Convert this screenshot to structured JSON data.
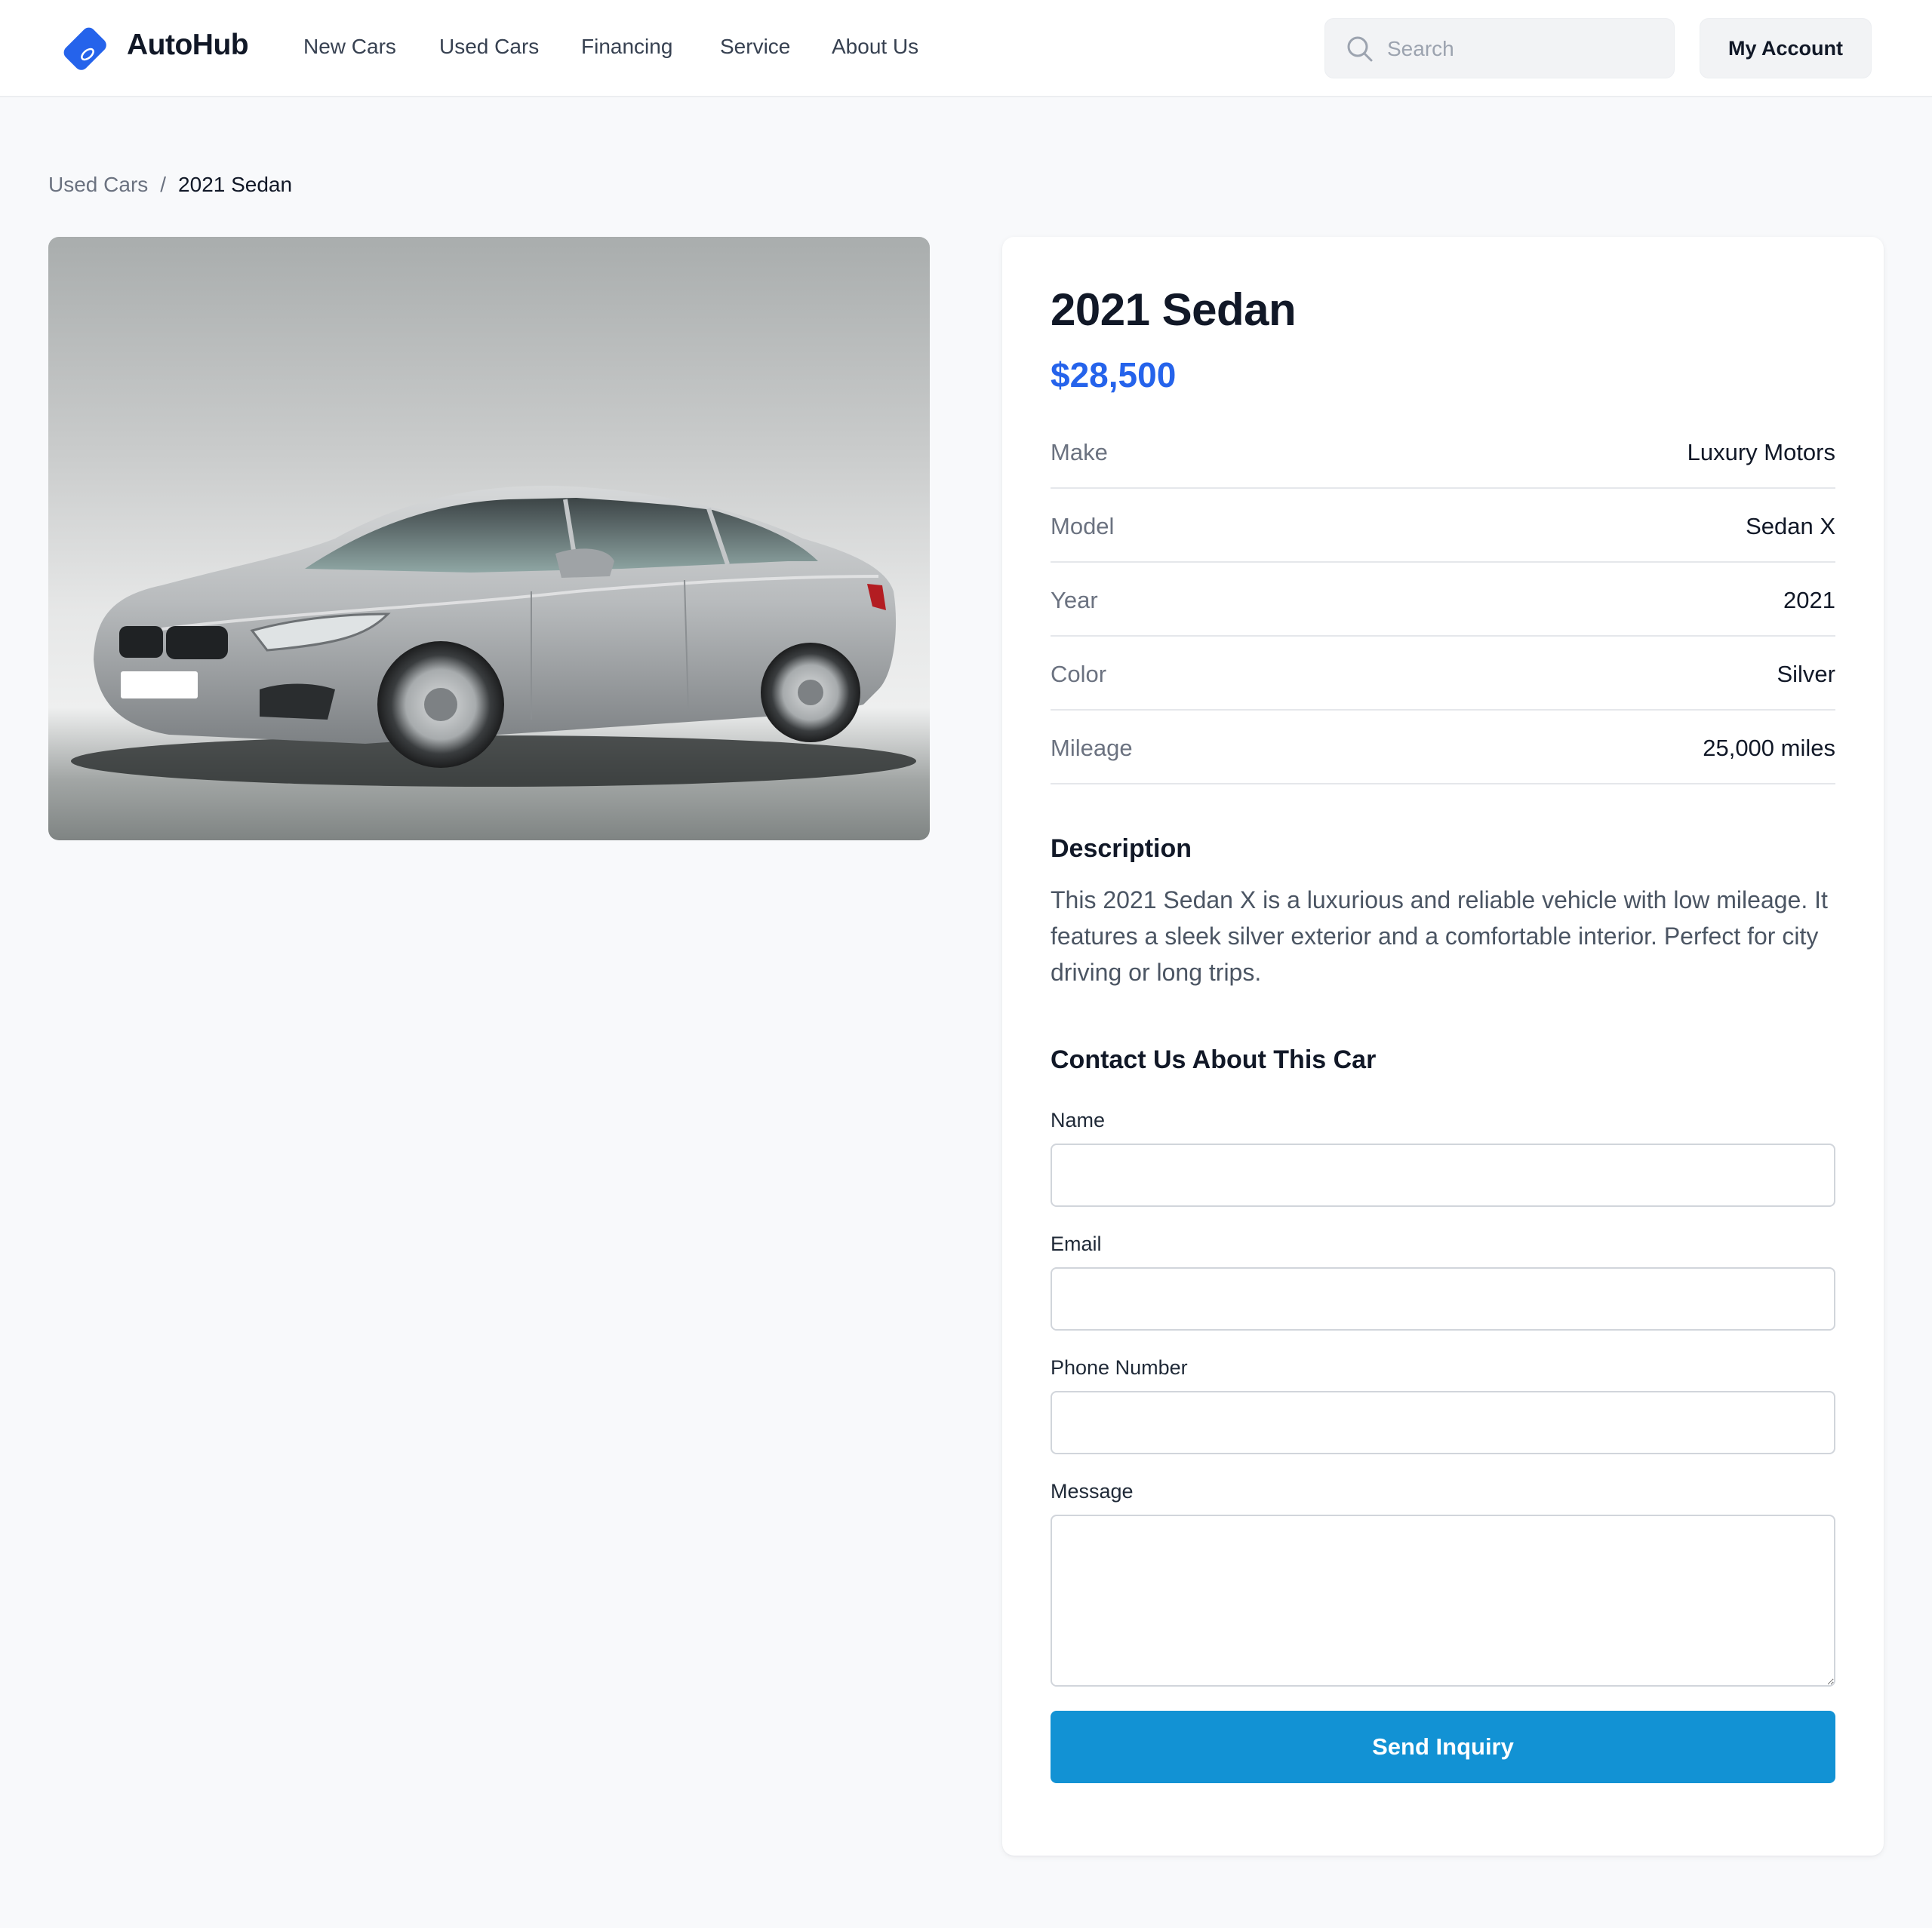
{
  "brand": {
    "name": "AutoHub",
    "accent": "#2563eb",
    "logo_icon": "tag-icon"
  },
  "nav": {
    "items": [
      {
        "label": "New Cars"
      },
      {
        "label": "Used Cars"
      },
      {
        "label": "Financing"
      },
      {
        "label": "Service"
      },
      {
        "label": "About Us"
      }
    ]
  },
  "search": {
    "placeholder": "Search",
    "value": "",
    "icon": "search-icon"
  },
  "account": {
    "label": "My Account"
  },
  "breadcrumb": {
    "parent": "Used Cars",
    "separator": "/",
    "current": "2021 Sedan"
  },
  "listing": {
    "photo_icon": "car-photo",
    "title": "2021 Sedan",
    "price": "$28,500",
    "price_color": "#2563eb",
    "specs": [
      {
        "label": "Make",
        "value": "Luxury Motors"
      },
      {
        "label": "Model",
        "value": "Sedan X"
      },
      {
        "label": "Year",
        "value": "2021"
      },
      {
        "label": "Color",
        "value": "Silver"
      },
      {
        "label": "Mileage",
        "value": "25,000 miles"
      }
    ],
    "description_heading": "Description",
    "description": "This 2021 Sedan X is a luxurious and reliable vehicle with low mileage. It features a sleek silver exterior and a comfortable interior. Perfect for city driving or long trips."
  },
  "contact": {
    "heading": "Contact Us About This Car",
    "fields": {
      "name": {
        "label": "Name",
        "value": ""
      },
      "email": {
        "label": "Email",
        "value": ""
      },
      "phone": {
        "label": "Phone Number",
        "value": ""
      },
      "message": {
        "label": "Message",
        "value": ""
      }
    },
    "submit_label": "Send Inquiry",
    "submit_color": "#1292d4"
  }
}
